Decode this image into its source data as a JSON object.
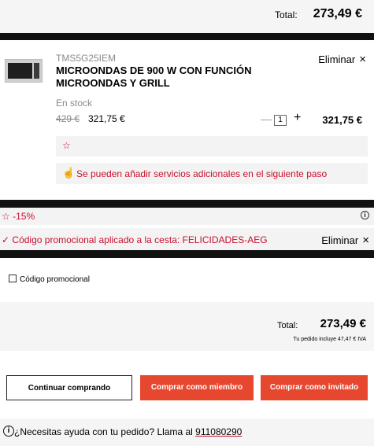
{
  "top_total": {
    "label": "Total:",
    "value": "273,49 €"
  },
  "product": {
    "sku": "TMS5G25IEM",
    "title": "MICROONDAS DE 900 W CON FUNCIÓN MICROONDAS Y GRILL",
    "remove_label": "Eliminar",
    "remove_icon": "×",
    "stock": "En stock",
    "price_old": "429 €",
    "price_new": "321,75 €",
    "quantity": "1",
    "minus": "—",
    "plus": "+",
    "line_total": "321,75 €",
    "favorite_icon": "☆",
    "services_icon": "☝",
    "services_text": "Se pueden añadir servicios adicionales en el siguiente paso"
  },
  "discount": {
    "icon": "☆",
    "text": "-15%",
    "info_icon": "i"
  },
  "promo_applied": {
    "check_icon": "✓",
    "text": "Código promocional aplicado a la cesta: FELICIDADES-AEG",
    "remove_label": "Eliminar",
    "remove_icon": "×"
  },
  "promo_code": {
    "label": "Código promocional"
  },
  "summary": {
    "label": "Total:",
    "value": "273,49 €",
    "vat_note": "Tu pedido incluye 47,47 € IVA"
  },
  "buttons": {
    "continue": "Continuar comprando",
    "member": "Comprar como miembro",
    "guest": "Comprar como invitado"
  },
  "help": {
    "info_icon": "i",
    "text": "¿Necesitas ayuda con tu pedido? Llama al ",
    "phone": "911080290"
  },
  "colors": {
    "accent": "#c8102e",
    "button": "#e8472f",
    "panel": "#f5f5f5",
    "divider": "#111111"
  }
}
